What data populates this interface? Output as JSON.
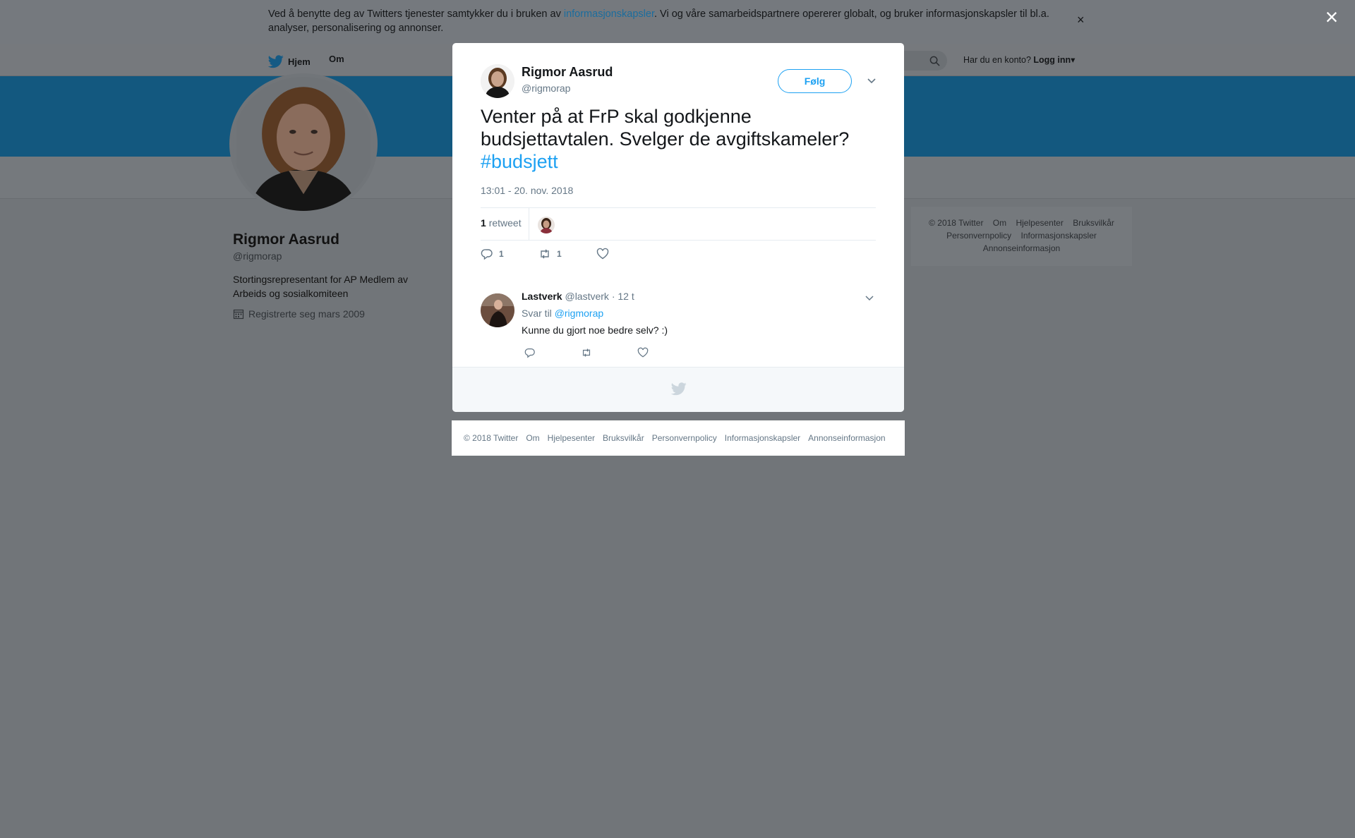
{
  "cookie_banner": {
    "text_before": "Ved å benytte deg av Twitters tjenester samtykker du i bruken av ",
    "link": "informasjonskapsler",
    "text_after": ". Vi og våre samarbeidspartnere opererer globalt, og bruker informasjonskapsler til bl.a. analyser, personalisering og annonser.",
    "close": "×"
  },
  "nav": {
    "home": "Hjem",
    "about": "Om",
    "login_prompt": "Har du en konto?",
    "login": "Logg inn",
    "login_caret": "▾"
  },
  "profile": {
    "name": "Rigmor Aasrud",
    "handle": "@rigmorap",
    "bio": "Stortingsrepresentant for AP Medlem av Arbeids og sosialkomiteen",
    "joined": "Registrerte seg mars 2009"
  },
  "side_footer": [
    "© 2018 Twitter",
    "Om",
    "Hjelpesenter",
    "Bruksvilkår",
    "Personvernpolicy",
    "Informasjonskapsler",
    "Annonseinformasjon"
  ],
  "overlay_close": "×",
  "tweet": {
    "name": "Rigmor Aasrud",
    "handle": "@rigmorap",
    "follow": "Følg",
    "text": "Venter på at FrP skal godkjenne budsjettavtalen. Svelger de avgiftskameler?",
    "hashtag": "#budsjett",
    "time": "13:01 - 20. nov. 2018",
    "retweet_count": "1",
    "retweet_label": "retweet",
    "reply_count": "1",
    "retweet_action_count": "1"
  },
  "reply": {
    "name": "Lastverk",
    "handle": "@lastverk",
    "time": "· 12 t",
    "reply_to_label": "Svar til",
    "reply_to_handle": "@rigmorap",
    "text": "Kunne du gjort noe bedre selv? :)"
  },
  "modal_footer": [
    "© 2018 Twitter",
    "Om",
    "Hjelpesenter",
    "Bruksvilkår",
    "Personvernpolicy",
    "Informasjonskapsler",
    "Annonseinformasjon"
  ],
  "colors": {
    "twitter_blue": "#1da1f2",
    "overlay": "#717579",
    "banner": "#13587f"
  }
}
